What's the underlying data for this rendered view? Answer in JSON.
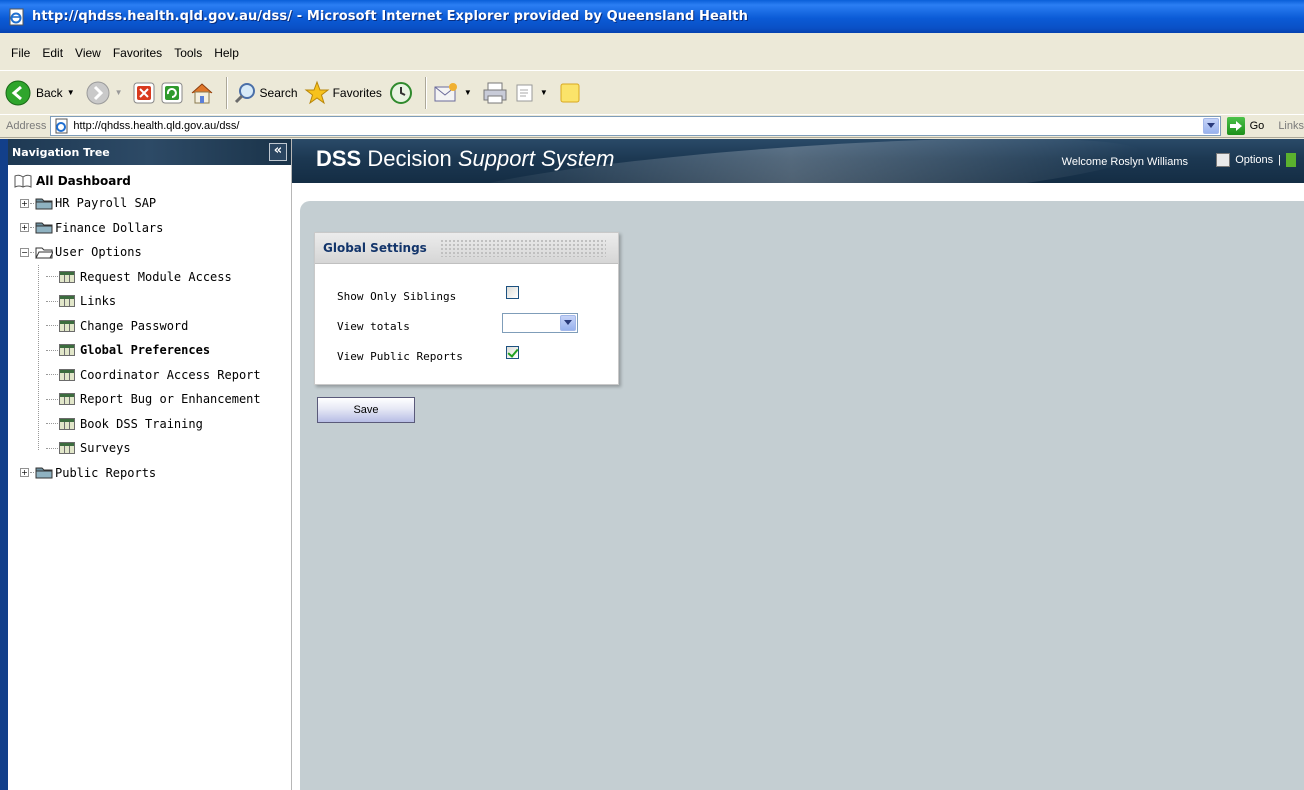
{
  "window": {
    "title": "http://qhdss.health.qld.gov.au/dss/ - Microsoft Internet Explorer provided by Queensland Health"
  },
  "menu": [
    "File",
    "Edit",
    "View",
    "Favorites",
    "Tools",
    "Help"
  ],
  "toolbar": {
    "back_label": "Back",
    "search_label": "Search",
    "favorites_label": "Favorites"
  },
  "address": {
    "label": "Address",
    "url": "http://qhdss.health.qld.gov.au/dss/",
    "go_label": "Go",
    "links_label": "Links"
  },
  "nav": {
    "header": "Navigation Tree",
    "collapse_symbol": "«",
    "root": "All Dashboard",
    "expand_plus": "+",
    "expand_minus": "−",
    "items": [
      {
        "label": "HR Payroll SAP"
      },
      {
        "label": "Finance Dollars"
      },
      {
        "label": "User Options"
      },
      {
        "label": "Public Reports"
      }
    ],
    "user_options_children": [
      "Request Module Access",
      "Links",
      "Change Password",
      "Global Preferences",
      "Coordinator Access Report",
      "Report Bug or Enhancement",
      "Book DSS Training",
      "Surveys"
    ]
  },
  "header": {
    "logo_bold": "DSS",
    "logo_regular": "Decision",
    "logo_italic": "Support System",
    "welcome": "Welcome Roslyn Williams",
    "options_label": "Options",
    "separator": "|"
  },
  "settings": {
    "title": "Global Settings",
    "show_only_siblings_label": "Show Only Siblings",
    "show_only_siblings_checked": false,
    "view_totals_label": "View totals",
    "view_totals_value": "",
    "view_public_reports_label": "View Public Reports",
    "view_public_reports_checked": true,
    "save_label": "Save"
  }
}
